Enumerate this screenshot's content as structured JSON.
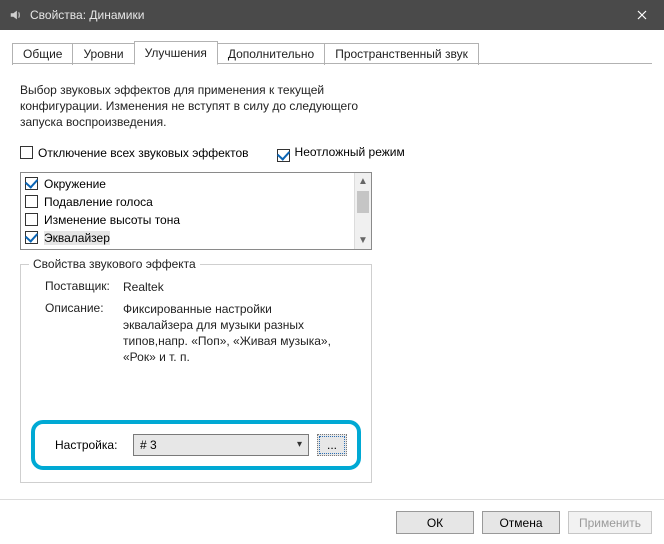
{
  "window": {
    "title": "Свойства: Динамики"
  },
  "tabs": [
    {
      "label": "Общие",
      "active": false
    },
    {
      "label": "Уровни",
      "active": false
    },
    {
      "label": "Улучшения",
      "active": true
    },
    {
      "label": "Дополнительно",
      "active": false
    },
    {
      "label": "Пространственный звук",
      "active": false
    }
  ],
  "intro": "Выбор звуковых эффектов для применения к текущей конфигурации. Изменения не вступят в силу до следующего запуска воспроизведения.",
  "options": {
    "disable_all": {
      "label": "Отключение всех звуковых эффектов",
      "checked": false
    },
    "immediate": {
      "label": "Неотложный режим",
      "checked": true
    }
  },
  "effects": [
    {
      "label": "Окружение",
      "checked": true,
      "selected": false
    },
    {
      "label": "Подавление голоса",
      "checked": false,
      "selected": false
    },
    {
      "label": "Изменение высоты тона",
      "checked": false,
      "selected": false
    },
    {
      "label": "Эквалайзер",
      "checked": true,
      "selected": true
    }
  ],
  "group": {
    "title": "Свойства звукового эффекта",
    "vendor_label": "Поставщик:",
    "vendor_value": "Realtek",
    "desc_label": "Описание:",
    "desc_value": "Фиксированные настройки эквалайзера для музыки разных типов,напр. «Поп», «Живая музыка», «Рок» и т. п.",
    "setting_label": "Настройка:",
    "setting_value": "# 3",
    "more_label": "..."
  },
  "buttons": {
    "ok": "ОК",
    "cancel": "Отмена",
    "apply": "Применить"
  }
}
